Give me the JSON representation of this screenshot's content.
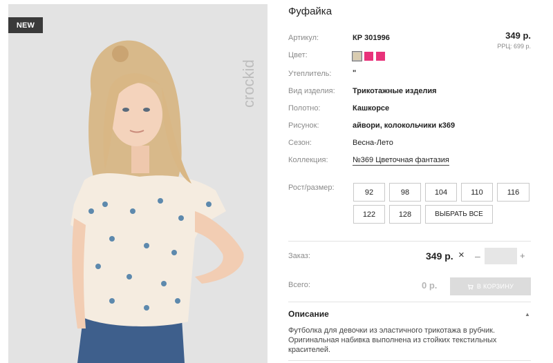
{
  "badge": "NEW",
  "brand": "crockid",
  "product": {
    "title": "Фуфайка",
    "article_label": "Артикул:",
    "article_value": "КР 301996",
    "price": "349 р.",
    "rrp": "РРЦ: 699 р.",
    "color_label": "Цвет:",
    "colors": [
      "#d9ccb0",
      "#e8327a",
      "#e8327a"
    ],
    "fields": [
      {
        "label": "Утеплитель:",
        "value": "\""
      },
      {
        "label": "Вид изделия:",
        "value": "Трикотажные изделия"
      },
      {
        "label": "Полотно:",
        "value": "Кашкорсе"
      },
      {
        "label": "Рисунок:",
        "value": "айвори, колокольчики к369"
      },
      {
        "label": "Сезон:",
        "value": "Весна-Лето"
      },
      {
        "label": "Коллекция:",
        "value": "№369 Цветочная фантазия"
      }
    ],
    "size_label": "Рост/размер:",
    "sizes": [
      "92",
      "98",
      "104",
      "110",
      "116",
      "122",
      "128"
    ],
    "select_all": "ВЫБРАТЬ ВСЕ"
  },
  "order": {
    "label": "Заказ:",
    "price": "349 р.",
    "times": "×",
    "minus": "–",
    "plus": "+",
    "quantity": ""
  },
  "total": {
    "label": "Всего:",
    "value": "0 р.",
    "cart_button": "В КОРЗИНУ"
  },
  "description": {
    "title": "Описание",
    "text": "Футболка для девочки из эластичного трикотажа в рубчик. Оригинальная набивка выполнена из стойких текстильных красителей."
  }
}
